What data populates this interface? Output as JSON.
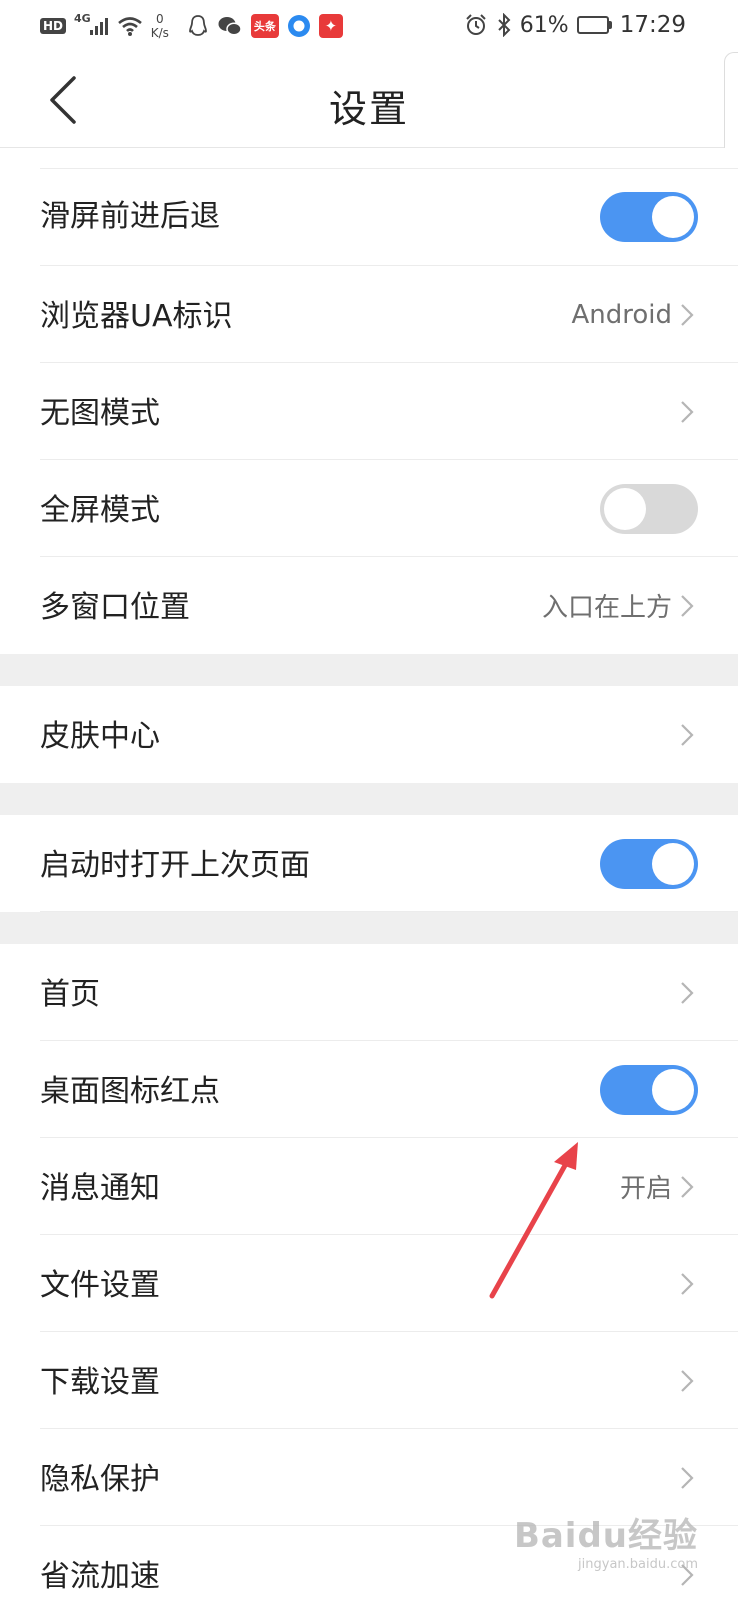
{
  "status_bar": {
    "hd": "HD",
    "network": "4G",
    "net_speed_value": "0",
    "net_speed_unit": "K/s",
    "app_icon_toutiao": "头条",
    "battery_percent": "61%",
    "battery_level": 0.61,
    "time": "17:29"
  },
  "header": {
    "title": "设置"
  },
  "settings": {
    "swipe_nav": {
      "label": "滑屏前进后退",
      "toggle_on": true
    },
    "browser_ua": {
      "label": "浏览器UA标识",
      "value": "Android"
    },
    "no_image_mode": {
      "label": "无图模式"
    },
    "fullscreen_mode": {
      "label": "全屏模式",
      "toggle_on": false
    },
    "multi_window": {
      "label": "多窗口位置",
      "value": "入口在上方"
    },
    "skin_center": {
      "label": "皮肤中心"
    },
    "open_last_page": {
      "label": "启动时打开上次页面",
      "toggle_on": true
    },
    "home_page": {
      "label": "首页"
    },
    "desktop_badge": {
      "label": "桌面图标红点",
      "toggle_on": true
    },
    "notifications": {
      "label": "消息通知",
      "value": "开启"
    },
    "file_settings": {
      "label": "文件设置"
    },
    "download_settings": {
      "label": "下载设置"
    },
    "privacy": {
      "label": "隐私保护"
    },
    "data_saver": {
      "label": "省流加速"
    }
  },
  "annotation": {
    "arrow_color": "#e8434a"
  },
  "watermark": {
    "logo": "Baidu经验",
    "sub": "jingyan.baidu.com"
  },
  "colors": {
    "toggle_on": "#4b95f2",
    "toggle_off": "#d9d9d9",
    "section_gap": "#efefef"
  }
}
